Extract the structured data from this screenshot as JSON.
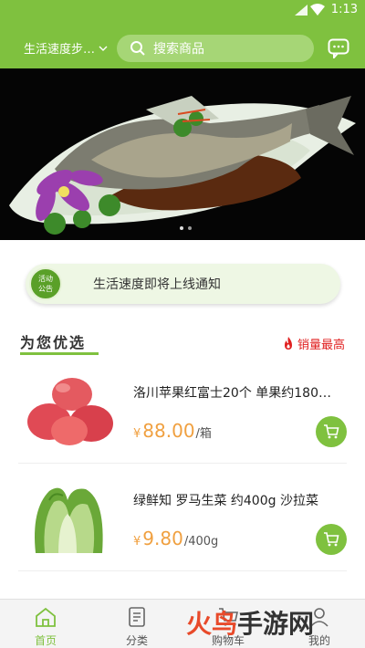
{
  "status_bar": {
    "time": "1:13"
  },
  "header": {
    "location": "生活速度步…",
    "search_placeholder": "搜索商品"
  },
  "notice": {
    "badge_line1": "活动",
    "badge_line2": "公告",
    "text": "生活速度即将上线通知"
  },
  "section": {
    "title": "为您优选",
    "hot_label": "销量最高"
  },
  "products": [
    {
      "name": "洛川苹果红富士20个 单果约180~…",
      "currency": "¥",
      "price": "88.00",
      "unit": "/箱"
    },
    {
      "name": "绿鲜知 罗马生菜 约400g 沙拉菜",
      "currency": "¥",
      "price": "9.80",
      "unit": "/400g"
    }
  ],
  "tabs": [
    {
      "label": "首页",
      "icon": "home-icon"
    },
    {
      "label": "分类",
      "icon": "category-icon"
    },
    {
      "label": "购物车",
      "icon": "cart-icon"
    },
    {
      "label": "我的",
      "icon": "user-icon"
    }
  ],
  "watermark": {
    "part1": "火鸟",
    "part2": "手游网"
  },
  "colors": {
    "brand_green": "#7fc13f",
    "price_orange": "#f0a040",
    "hot_red": "#e02020"
  }
}
